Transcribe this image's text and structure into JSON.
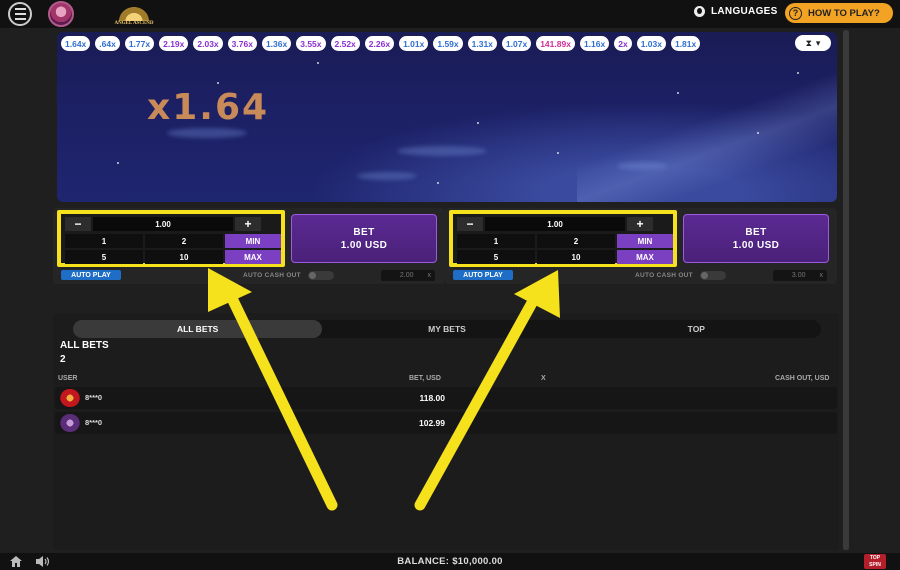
{
  "header": {
    "logo_text": "ANGEL ASCEND",
    "languages_label": "LANGUAGES",
    "how_to_play_label": "HOW TO PLAY?"
  },
  "game": {
    "multiplier": "x1.64",
    "history": [
      {
        "value": "1.64x",
        "color": "blue"
      },
      {
        "value": ".64x",
        "color": "blue"
      },
      {
        "value": "1.77x",
        "color": "blue"
      },
      {
        "value": "2.19x",
        "color": "purple"
      },
      {
        "value": "2.03x",
        "color": "purple"
      },
      {
        "value": "3.76x",
        "color": "purple"
      },
      {
        "value": "1.36x",
        "color": "blue"
      },
      {
        "value": "3.55x",
        "color": "purple"
      },
      {
        "value": "2.52x",
        "color": "purple"
      },
      {
        "value": "2.26x",
        "color": "purple"
      },
      {
        "value": "1.01x",
        "color": "blue"
      },
      {
        "value": "1.59x",
        "color": "blue"
      },
      {
        "value": "1.31x",
        "color": "blue"
      },
      {
        "value": "1.07x",
        "color": "blue"
      },
      {
        "value": "141.89x",
        "color": "pink"
      },
      {
        "value": "1.16x",
        "color": "blue"
      },
      {
        "value": "2x",
        "color": "purple"
      },
      {
        "value": "1.03x",
        "color": "blue"
      },
      {
        "value": "1.81x",
        "color": "blue"
      }
    ]
  },
  "bet_panels": [
    {
      "minus": "−",
      "plus": "+",
      "amount": "1.00",
      "quick": [
        "1",
        "2",
        "MIN",
        "5",
        "10",
        "MAX"
      ],
      "bet_label": "BET",
      "bet_amount": "1.00 USD",
      "auto_play": "AUTO PLAY",
      "auto_cash_out": "AUTO CASH OUT",
      "cash_out_value": "2.00",
      "cash_out_clear": "x"
    },
    {
      "minus": "−",
      "plus": "+",
      "amount": "1.00",
      "quick": [
        "1",
        "2",
        "MIN",
        "5",
        "10",
        "MAX"
      ],
      "bet_label": "BET",
      "bet_amount": "1.00 USD",
      "auto_play": "AUTO PLAY",
      "auto_cash_out": "AUTO CASH OUT",
      "cash_out_value": "3.00",
      "cash_out_clear": "x"
    }
  ],
  "bets": {
    "tabs": [
      "ALL BETS",
      "MY BETS",
      "TOP"
    ],
    "title": "ALL BETS",
    "count": "2",
    "columns": {
      "user": "USER",
      "bet": "BET, USD",
      "x": "X",
      "cash_out": "CASH OUT, USD"
    },
    "rows": [
      {
        "user": "8***0",
        "bet": "118.00"
      },
      {
        "user": "8***0",
        "bet": "102.99"
      }
    ]
  },
  "footer": {
    "balance": "BALANCE: $10,000.00",
    "provider": "TOP SPIN"
  },
  "colors": {
    "highlight": "#f5e11c",
    "accent": "#f2a323",
    "bet_button": "#5b2a93",
    "min_max": "#7b3fc2"
  }
}
